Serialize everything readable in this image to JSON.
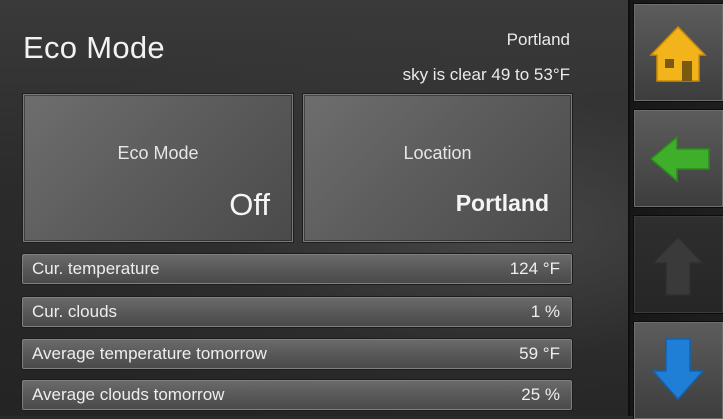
{
  "header": {
    "title": "Eco Mode",
    "city": "Portland",
    "forecast": "sky is clear 49 to 53°F"
  },
  "tiles": [
    {
      "label": "Eco Mode",
      "value": "Off"
    },
    {
      "label": "Location",
      "value": "Portland"
    }
  ],
  "rows": [
    {
      "label": "Cur. temperature",
      "value": "124 °F"
    },
    {
      "label": "Cur. clouds",
      "value": "1 %"
    },
    {
      "label": "Average temperature tomorrow",
      "value": "59 °F"
    },
    {
      "label": "Average clouds tomorrow",
      "value": "25 %"
    }
  ],
  "nav": {
    "home_icon": "home-icon",
    "back_icon": "arrow-left-icon",
    "up_icon": "arrow-up-icon",
    "down_icon": "arrow-down-icon"
  },
  "colors": {
    "home": "#f2b31b",
    "back": "#3fae2a",
    "up_disabled": "#3a3a3a",
    "down": "#1f7fd6"
  }
}
